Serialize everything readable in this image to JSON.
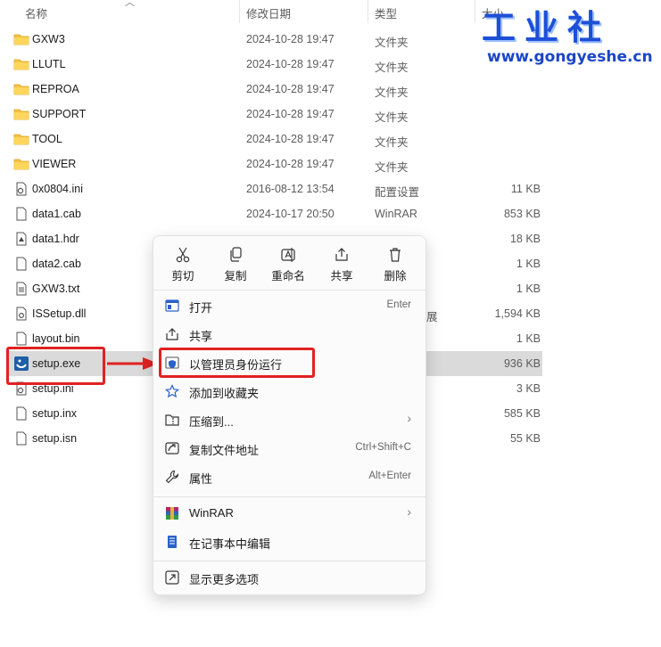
{
  "header": {
    "name": "名称",
    "modified": "修改日期",
    "type": "类型",
    "size": "大小"
  },
  "files": [
    {
      "name": "GXW3",
      "date": "2024-10-28 19:47",
      "type": "文件夹",
      "size": "",
      "icon": "folder-icon"
    },
    {
      "name": "LLUTL",
      "date": "2024-10-28 19:47",
      "type": "文件夹",
      "size": "",
      "icon": "folder-icon"
    },
    {
      "name": "REPROA",
      "date": "2024-10-28 19:47",
      "type": "文件夹",
      "size": "",
      "icon": "folder-icon"
    },
    {
      "name": "SUPPORT",
      "date": "2024-10-28 19:47",
      "type": "文件夹",
      "size": "",
      "icon": "folder-icon"
    },
    {
      "name": "TOOL",
      "date": "2024-10-28 19:47",
      "type": "文件夹",
      "size": "",
      "icon": "folder-icon"
    },
    {
      "name": "VIEWER",
      "date": "2024-10-28 19:47",
      "type": "文件夹",
      "size": "",
      "icon": "folder-icon"
    },
    {
      "name": "0x0804.ini",
      "date": "2016-08-12 13:54",
      "type": "配置设置",
      "size": "11 KB",
      "icon": "settings-file-icon"
    },
    {
      "name": "data1.cab",
      "date": "2024-10-17 20:50",
      "type": "WinRAR",
      "size": "853 KB",
      "icon": "file-icon"
    },
    {
      "name": "data1.hdr",
      "date": "",
      "type": "",
      "size": "18 KB",
      "icon": "hdr-file-icon"
    },
    {
      "name": "data2.cab",
      "date": "",
      "type": "",
      "size": "1 KB",
      "icon": "file-icon"
    },
    {
      "name": "GXW3.txt",
      "date": "",
      "type": "",
      "size": "1 KB",
      "icon": "text-file-icon"
    },
    {
      "name": "ISSetup.dll",
      "date": "",
      "type": "展",
      "size": "1,594 KB",
      "icon": "dll-file-icon"
    },
    {
      "name": "layout.bin",
      "date": "",
      "type": "",
      "size": "1 KB",
      "icon": "file-icon"
    },
    {
      "name": "setup.exe",
      "date": "",
      "type": "",
      "size": "936 KB",
      "icon": "setup-exe-icon"
    },
    {
      "name": "setup.ini",
      "date": "",
      "type": "",
      "size": "3 KB",
      "icon": "settings-file-icon"
    },
    {
      "name": "setup.inx",
      "date": "",
      "type": "",
      "size": "585 KB",
      "icon": "file-icon"
    },
    {
      "name": "setup.isn",
      "date": "",
      "type": "",
      "size": "55 KB",
      "icon": "file-icon"
    }
  ],
  "context_menu": {
    "quick_actions": [
      {
        "label": "剪切",
        "icon": "scissors-icon"
      },
      {
        "label": "复制",
        "icon": "copy-icon"
      },
      {
        "label": "重命名",
        "icon": "rename-icon"
      },
      {
        "label": "共享",
        "icon": "share-icon"
      },
      {
        "label": "删除",
        "icon": "trash-icon"
      }
    ],
    "items": [
      {
        "label": "打开",
        "shortcut": "Enter",
        "icon": "open-icon"
      },
      {
        "label": "共享",
        "shortcut": "",
        "icon": "share-icon"
      },
      {
        "label": "以管理员身份运行",
        "shortcut": "",
        "icon": "admin-shield-icon"
      },
      {
        "label": "添加到收藏夹",
        "shortcut": "",
        "icon": "star-icon"
      },
      {
        "label": "压缩到...",
        "shortcut": "",
        "icon": "zip-folder-icon",
        "submenu": true
      },
      {
        "label": "复制文件地址",
        "shortcut": "Ctrl+Shift+C",
        "icon": "copy-path-icon"
      },
      {
        "label": "属性",
        "shortcut": "Alt+Enter",
        "icon": "wrench-icon"
      },
      {
        "label": "WinRAR",
        "shortcut": "",
        "icon": "winrar-icon",
        "submenu": true
      },
      {
        "label": "在记事本中编辑",
        "shortcut": "",
        "icon": "notepad-icon"
      },
      {
        "label": "显示更多选项",
        "shortcut": "",
        "icon": "more-options-icon"
      }
    ]
  },
  "watermark": {
    "title": "工业社",
    "url": "www.gongyeshe.cn"
  },
  "colors": {
    "highlight_red": "#e02222",
    "selected_row": "#dadada",
    "folder": "#f6c343",
    "watermark_blue": "#1d4fd8"
  }
}
